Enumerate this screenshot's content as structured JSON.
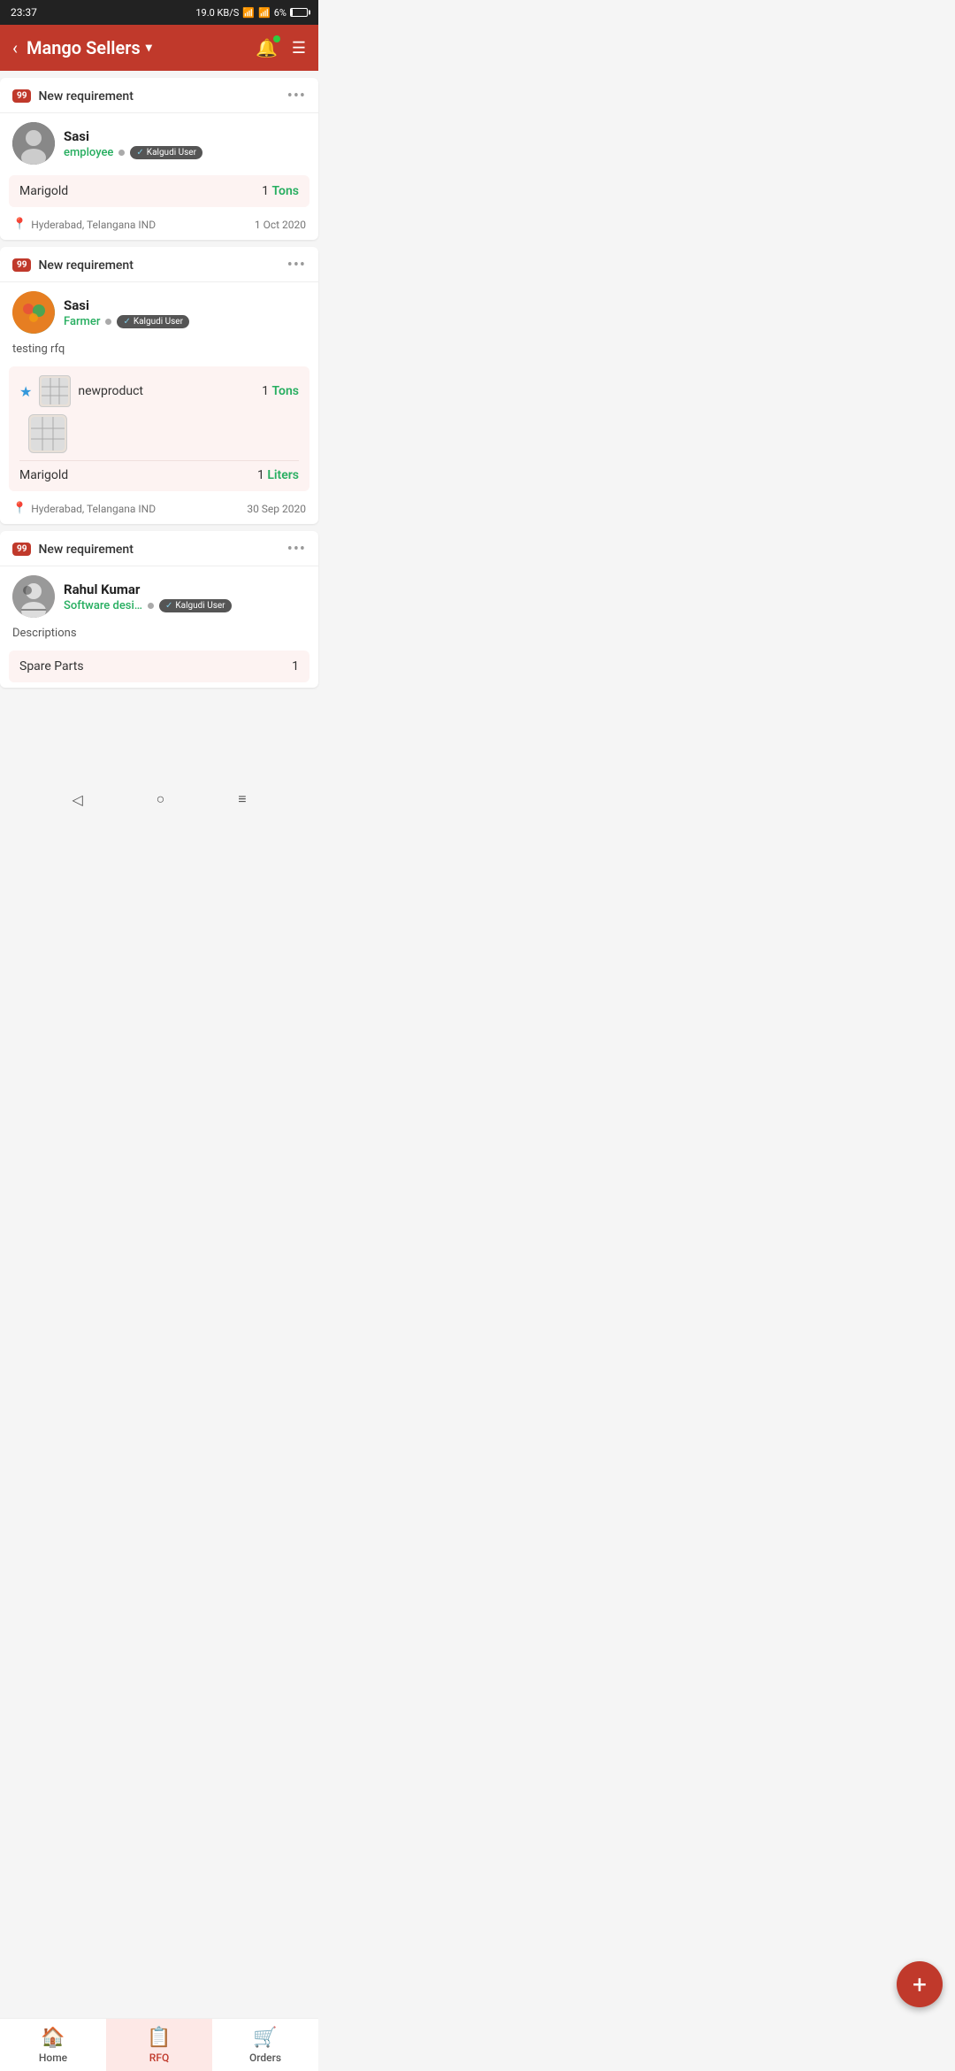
{
  "statusBar": {
    "time": "23:37",
    "speed": "19.0 KB/S",
    "battery": "6%"
  },
  "header": {
    "title": "Mango Sellers",
    "backLabel": "‹",
    "chevron": "▾"
  },
  "cards": [
    {
      "id": "card1",
      "badgeLabel": "99",
      "headerTitle": "New requirement",
      "user": {
        "name": "Sasi",
        "role": "employee",
        "roleDisplay": "employee",
        "kalgudi": "Kalgudi User"
      },
      "products": [
        {
          "name": "Marigold",
          "qty": "1",
          "unit": "Tons"
        }
      ],
      "location": "Hyderabad, Telangana IND",
      "date": "1 Oct 2020"
    },
    {
      "id": "card2",
      "badgeLabel": "99",
      "headerTitle": "New requirement",
      "user": {
        "name": "Sasi",
        "role": "farmer",
        "roleDisplay": "Farmer",
        "kalgudi": "Kalgudi User"
      },
      "note": "testing rfq",
      "products": [
        {
          "name": "newproduct",
          "qty": "1",
          "unit": "Tons",
          "hasStar": true,
          "hasThumb": true
        },
        {
          "name": "Marigold",
          "qty": "1",
          "unit": "Liters",
          "hasThumbOnly": true
        }
      ],
      "location": "Hyderabad, Telangana IND",
      "date": "30 Sep 2020"
    },
    {
      "id": "card3",
      "badgeLabel": "99",
      "headerTitle": "New requirement",
      "user": {
        "name": "Rahul Kumar",
        "role": "software",
        "roleDisplay": "Software desi…",
        "kalgudi": "Kalgudi User"
      },
      "note": "Descriptions",
      "products": [
        {
          "name": "Spare Parts",
          "qty": "1",
          "unit": ""
        }
      ],
      "location": "",
      "date": ""
    }
  ],
  "fab": {
    "label": "+"
  },
  "bottomNav": {
    "items": [
      {
        "id": "home",
        "label": "Home",
        "icon": "🏠",
        "active": false
      },
      {
        "id": "rfq",
        "label": "RFQ",
        "icon": "📋",
        "active": true
      },
      {
        "id": "orders",
        "label": "Orders",
        "icon": "🛒",
        "active": false
      }
    ]
  },
  "androidNav": {
    "back": "◁",
    "home": "○",
    "menu": "≡"
  }
}
